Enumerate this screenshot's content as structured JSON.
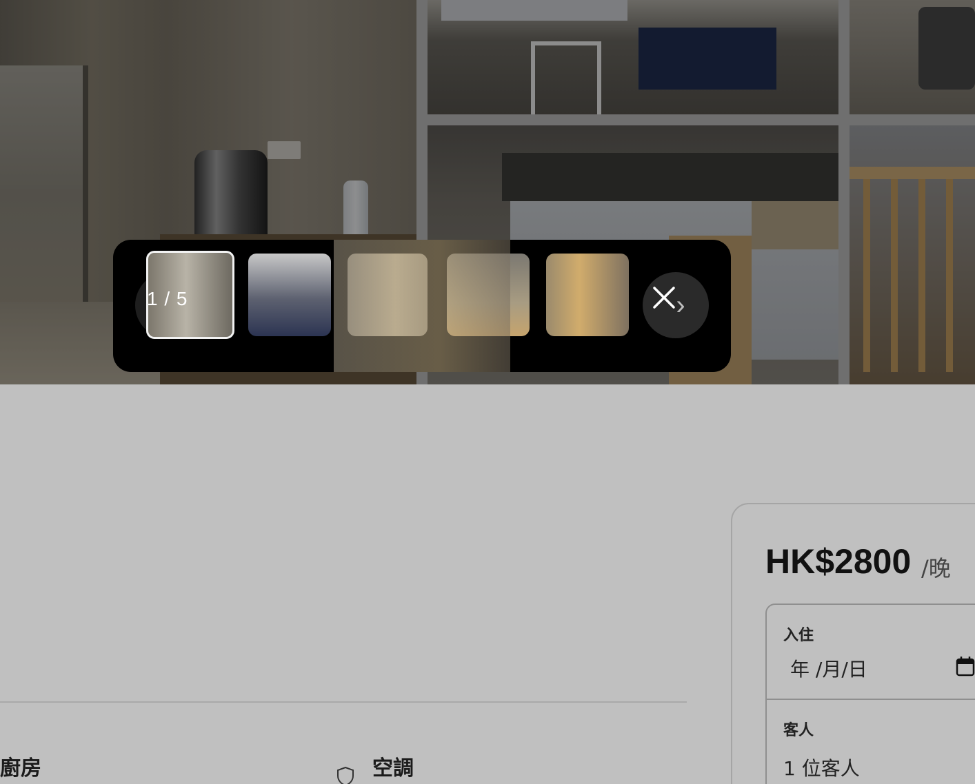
{
  "lightbox": {
    "counter": "1 / 5",
    "thumbnails": [
      {
        "name": "thumbnail-1",
        "active": true
      },
      {
        "name": "thumbnail-2",
        "active": false
      },
      {
        "name": "thumbnail-3",
        "active": false
      },
      {
        "name": "thumbnail-4",
        "active": false
      },
      {
        "name": "thumbnail-5",
        "active": false
      }
    ],
    "prev_icon": "chevron-left-icon",
    "next_icon": "chevron-right-icon",
    "close_icon": "close-icon"
  },
  "amenities": {
    "kitchen": "廚房",
    "ac": "空調"
  },
  "booking": {
    "price": "HK$2800",
    "per_night": "/晚",
    "checkin_label": "入住",
    "checkin_value": "年 /月/日",
    "guests_label": "客人",
    "guests_value": "1 位客人"
  },
  "colors": {
    "overlay": "#000000",
    "page_bg": "#c0c0c0",
    "text": "#111111"
  }
}
